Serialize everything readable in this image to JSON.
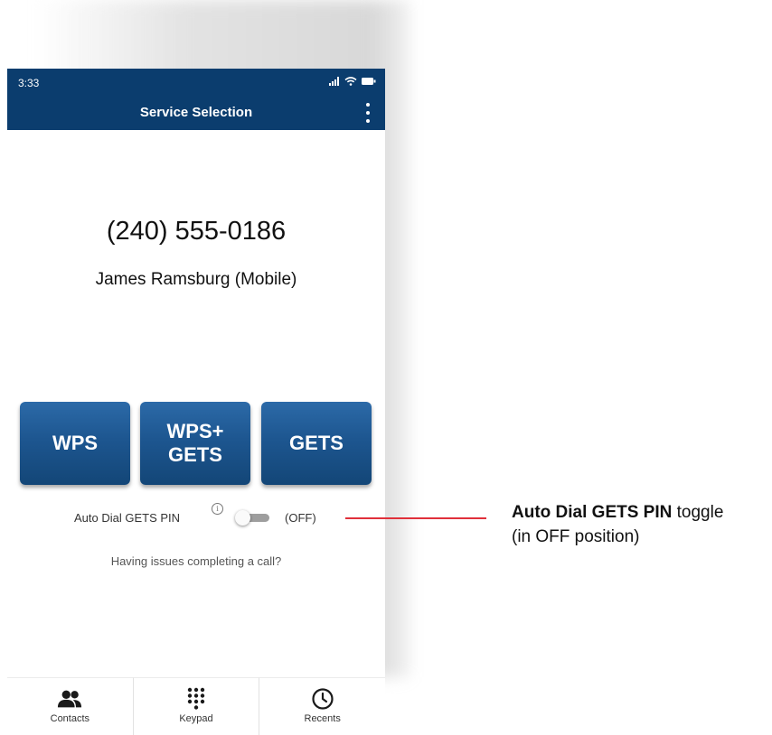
{
  "status_bar": {
    "time": "3:33"
  },
  "app_bar": {
    "title": "Service Selection"
  },
  "call": {
    "number": "(240) 555-0186",
    "contact": "James Ramsburg (Mobile)"
  },
  "services": [
    {
      "label": "WPS"
    },
    {
      "label": "WPS+\nGETS"
    },
    {
      "label": "GETS"
    }
  ],
  "auto_dial": {
    "label": "Auto Dial GETS PIN",
    "state": "(OFF)",
    "enabled": false
  },
  "issues_link": "Having issues completing a call?",
  "bottom_nav": [
    {
      "label": "Contacts",
      "icon": "contacts-icon"
    },
    {
      "label": "Keypad",
      "icon": "keypad-icon"
    },
    {
      "label": "Recents",
      "icon": "clock-icon"
    }
  ],
  "callout": {
    "bold": "Auto Dial GETS PIN",
    "rest": " toggle",
    "line2": "(in OFF position)"
  },
  "colors": {
    "app_bar": "#0b3d6e",
    "button": "#1d5690",
    "callout_line": "#e0303a"
  }
}
